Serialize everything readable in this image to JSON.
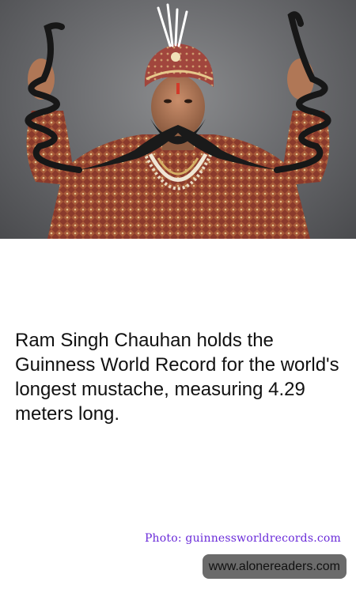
{
  "fact": {
    "text": "Ram Singh Chauhan holds the Guinness World Record for the world's longest mustache, measuring 4.29 meters long."
  },
  "photo_credit": "Photo: guinnessworldrecords.com",
  "site_watermark": "www.alonereaders.com",
  "photo": {
    "subject": "Man in red turban and embroidered sherwani holding up a very long mustache"
  },
  "colors": {
    "credit_text": "#6a2bd9",
    "pill_background": "#6b6b6b",
    "body_text": "#111111"
  }
}
